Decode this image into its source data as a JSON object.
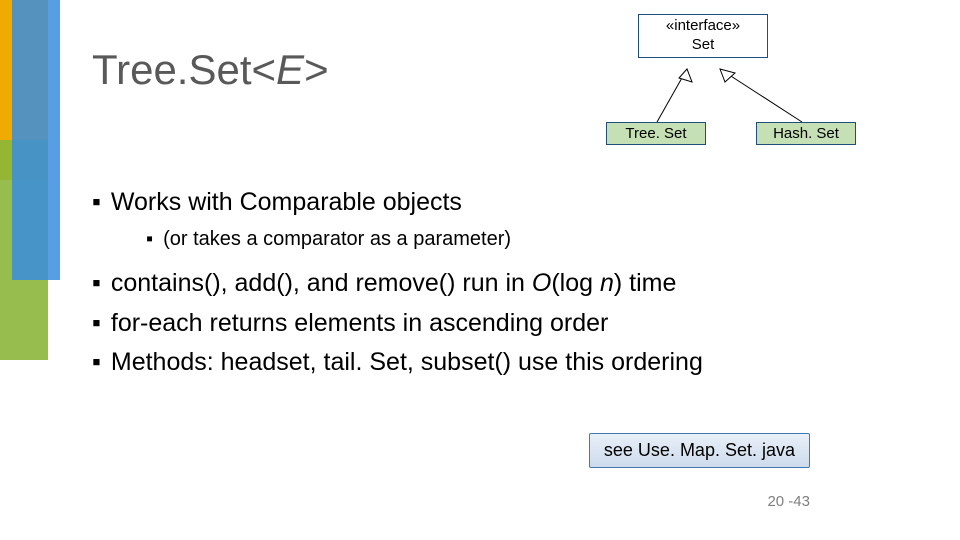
{
  "title": {
    "pre": "Tree.Set<",
    "generic": "E",
    "post": ">"
  },
  "diagram": {
    "stereotype": "«interface»",
    "interface_name": "Set",
    "impl_left": "Tree. Set",
    "impl_right": "Hash. Set"
  },
  "bullets": {
    "b1": "Works with Comparable objects",
    "b1a": "(or takes a comparator as a parameter)",
    "b2_pre": "contains(), add(), and remove() run in ",
    "b2_ital_a": "O",
    "b2_mid": "(log ",
    "b2_ital_b": "n",
    "b2_post": ") time",
    "b3": "for-each returns elements in ascending order",
    "b4": "Methods: headset, tail. Set, subset() use this ordering"
  },
  "seebox": "see Use. Map. Set. java",
  "pagenum": "20 -43"
}
